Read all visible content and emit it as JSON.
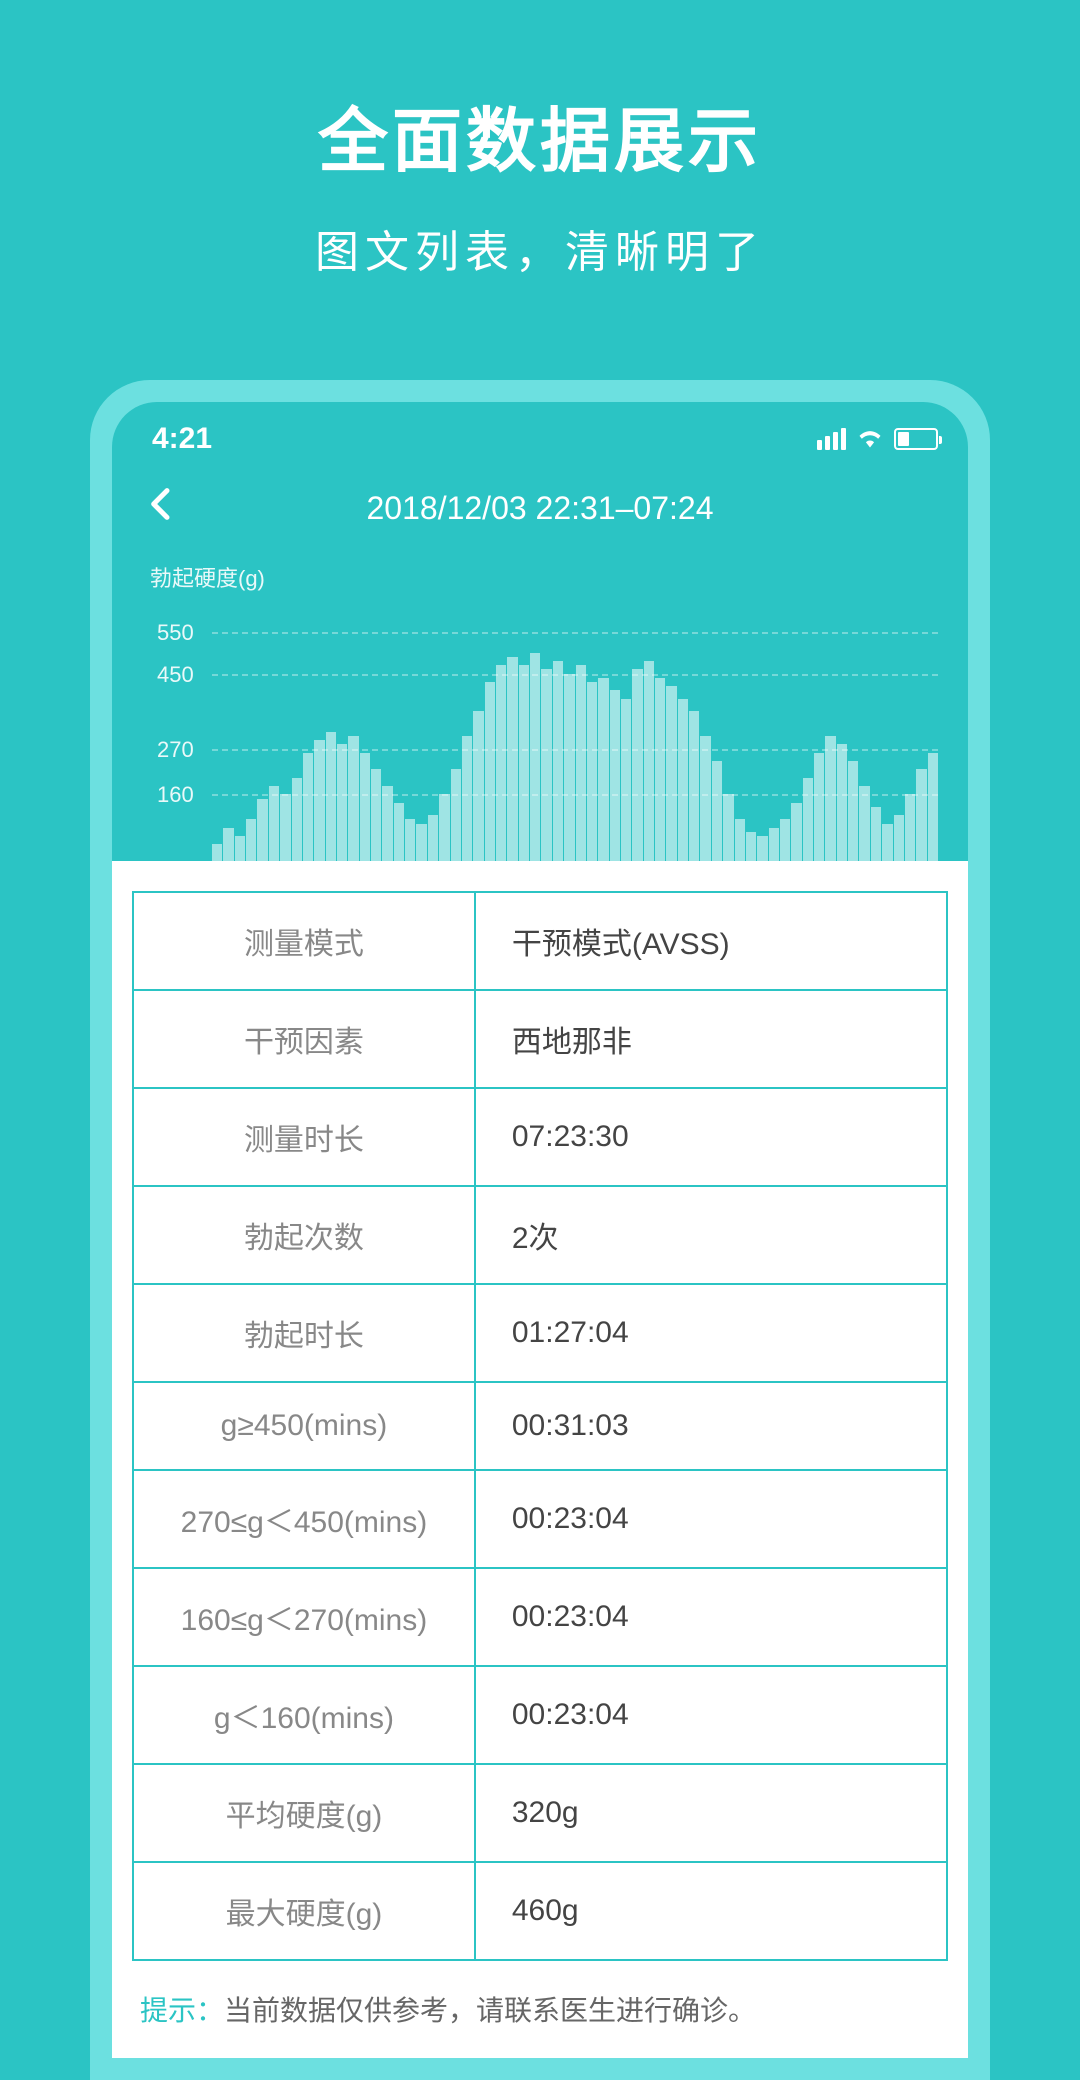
{
  "promo": {
    "title": "全面数据展示",
    "subtitle": "图文列表，清晰明了"
  },
  "status": {
    "time": "4:21"
  },
  "header": {
    "title": "2018/12/03 22:31–07:24"
  },
  "chart_data": {
    "type": "bar",
    "ylabel": "勃起硬度(g)",
    "ylim": [
      0,
      600
    ],
    "ticks": [
      550,
      450,
      270,
      160
    ],
    "values": [
      40,
      80,
      60,
      100,
      150,
      180,
      160,
      200,
      260,
      290,
      310,
      280,
      300,
      260,
      220,
      180,
      140,
      100,
      90,
      110,
      160,
      220,
      300,
      360,
      430,
      470,
      490,
      470,
      500,
      460,
      480,
      450,
      470,
      430,
      440,
      410,
      390,
      460,
      480,
      440,
      420,
      390,
      360,
      300,
      240,
      160,
      100,
      70,
      60,
      80,
      100,
      140,
      200,
      260,
      300,
      280,
      240,
      180,
      130,
      90,
      110,
      160,
      220,
      260
    ]
  },
  "table": {
    "rows": [
      {
        "label": "测量模式",
        "value": "干预模式(AVSS)"
      },
      {
        "label": "干预因素",
        "value": "西地那非"
      },
      {
        "label": "测量时长",
        "value": "07:23:30"
      },
      {
        "label": "勃起次数",
        "value": "2次"
      },
      {
        "label": "勃起时长",
        "value": "01:27:04"
      },
      {
        "label": "g≥450(mins)",
        "value": "00:31:03"
      },
      {
        "label": "270≤g＜450(mins)",
        "value": "00:23:04"
      },
      {
        "label": "160≤g＜270(mins)",
        "value": "00:23:04"
      },
      {
        "label": "g＜160(mins)",
        "value": "00:23:04"
      },
      {
        "label": "平均硬度(g)",
        "value": "320g"
      },
      {
        "label": "最大硬度(g)",
        "value": "460g"
      }
    ]
  },
  "hint": {
    "label": "提示：",
    "text": "当前数据仅供参考，请联系医生进行确诊。"
  }
}
